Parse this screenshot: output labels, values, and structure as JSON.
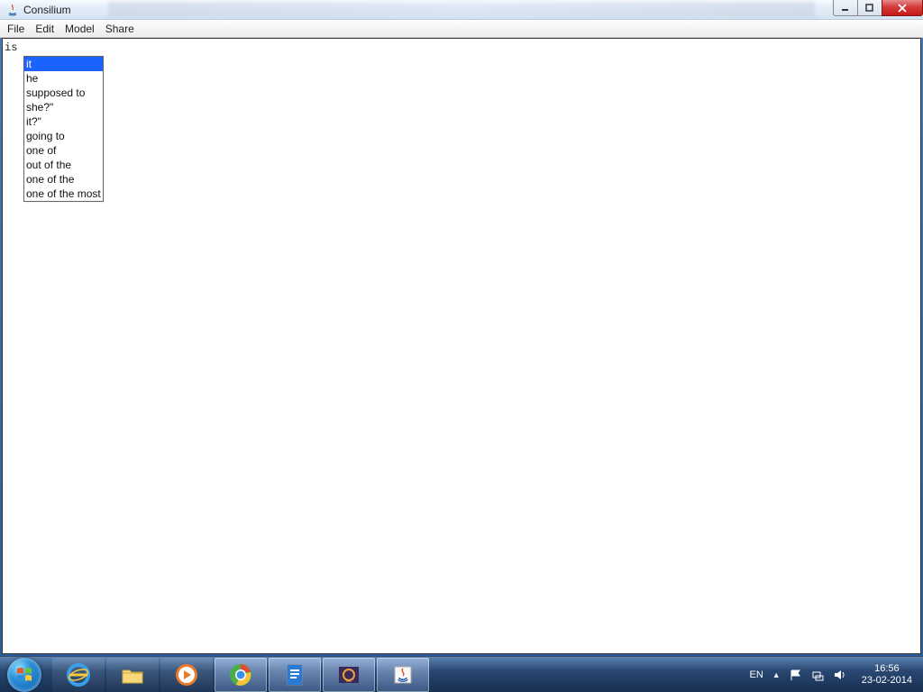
{
  "window": {
    "title": "Consilium"
  },
  "menu": {
    "items": [
      "File",
      "Edit",
      "Model",
      "Share"
    ]
  },
  "editor": {
    "text": "is"
  },
  "autocomplete": {
    "selected_index": 0,
    "items": [
      "it",
      "he",
      "supposed to",
      "she?\"",
      "it?\"",
      "going to",
      "one of",
      "out of the",
      "one of the",
      "one of the most"
    ]
  },
  "taskbar": {
    "language": "EN",
    "time": "16:56",
    "date": "23-02-2014"
  }
}
